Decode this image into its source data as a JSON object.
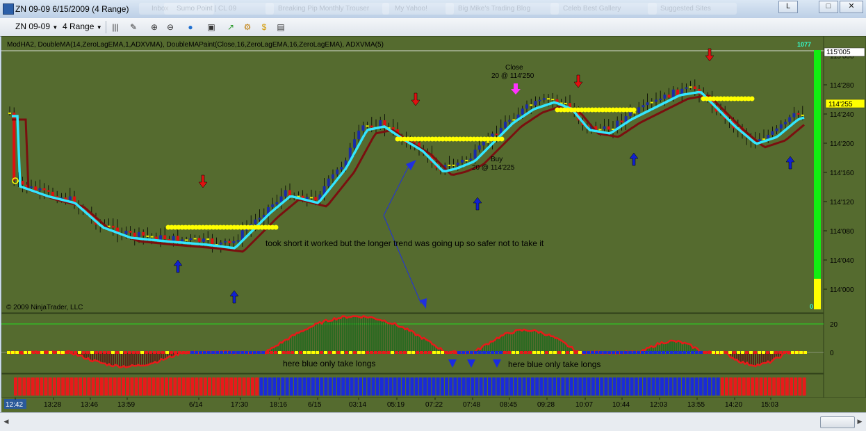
{
  "window": {
    "title": "ZN 09-09  6/15/2009 (4 Range)",
    "background_tabs": [
      "Inbox",
      "Sumo Point | CL 09",
      "Breaking Pip Monthly Trouser",
      "My Yahoo!",
      "Big Mike's Trading Blog",
      "Celeb Best Gallery",
      "Suggested Sites"
    ],
    "buttons": {
      "minimize": "L",
      "restore": "□",
      "close": "✕"
    }
  },
  "toolbar": {
    "instrument": "ZN 09-09",
    "interval": "4 Range",
    "icons": [
      "bar-style-icon",
      "draw-tool-icon",
      "zoom-in-icon",
      "zoom-out-icon",
      "globe-icon",
      "properties-icon",
      "indicators-icon",
      "strategy-icon",
      "data-box-icon"
    ]
  },
  "chart": {
    "indicator_label": "ModHA2, DoubleMA(14,ZeroLagEMA,1,ADXVMA), DoubleMAPaint(Close,16,ZeroLagEMA,16,ZeroLagEMA), ADXVMA(5)",
    "copyright": "© 2009 NinjaTrader, LLC",
    "y_axis": {
      "ticks": [
        "115'000",
        "114'280",
        "114'240",
        "114'200",
        "114'160",
        "114'120",
        "114'080",
        "114'040",
        "114'000"
      ],
      "current_price": "114'255",
      "top_price": "115'005",
      "range_min": 113.97,
      "range_max": 115.02
    },
    "volume_meter": {
      "top_label": "1077",
      "bottom_label": "0",
      "green_fraction": 0.9
    },
    "x_axis": {
      "ticks": [
        "12:42",
        "13:28",
        "13:46",
        "13:59",
        "6/14",
        "17:30",
        "18:16",
        "6/15",
        "03:14",
        "05:19",
        "07:22",
        "07:48",
        "08:45",
        "09:28",
        "10:07",
        "10:44",
        "12:03",
        "13:55",
        "14:20",
        "15:03"
      ]
    },
    "annotations": {
      "close": "Close",
      "close_detail": "20 @ 114'250",
      "buy": "Buy",
      "buy_detail": "20 @ 114'225",
      "comment": "took short it worked but the longer trend was going up so safer not to take it",
      "longs_note_1": "here blue only take longs",
      "longs_note_2": "here blue only take longs"
    },
    "oscillator": {
      "ticks": [
        "20",
        "0"
      ]
    },
    "colors": {
      "background": "#556b2f",
      "up_bar": "#1a2ba8",
      "down_bar": "#e01010",
      "neutral_bar": "#f2f200",
      "fast_ma": "#33e6ff",
      "slow_ma_up": "#22dd22",
      "slow_ma_down": "#7a0f0f",
      "arrow_up": "#1020d0",
      "arrow_down": "#e01010",
      "trend_blue": "#1a2bd8",
      "trend_red": "#e81a1a"
    }
  }
}
